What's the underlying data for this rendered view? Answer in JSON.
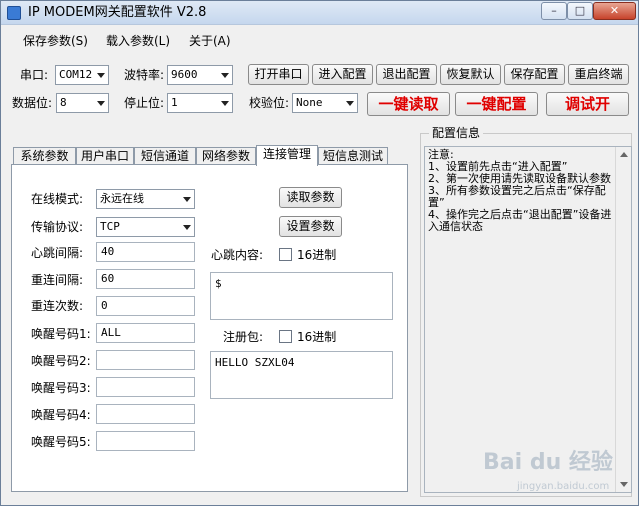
{
  "window": {
    "title": "IP MODEM网关配置软件 V2.8"
  },
  "menu": [
    "保存参数(S)",
    "载入参数(L)",
    "关于(A)"
  ],
  "serial": {
    "port_label": "串口:",
    "port_value": "COM12",
    "baud_label": "波特率:",
    "baud_value": "9600",
    "databits_label": "数据位:",
    "databits_value": "8",
    "stopbits_label": "停止位:",
    "stopbits_value": "1",
    "parity_label": "校验位:",
    "parity_value": "None"
  },
  "toolbar_buttons": [
    "打开串口",
    "进入配置",
    "退出配置",
    "恢复默认",
    "保存配置",
    "重启终端"
  ],
  "action_buttons": [
    "一键读取",
    "一键配置",
    "调试开"
  ],
  "tabs": [
    "系统参数",
    "用户串口",
    "短信通道",
    "网络参数",
    "连接管理",
    "短信息测试"
  ],
  "conn": {
    "online_mode_label": "在线模式:",
    "online_mode_value": "永远在线",
    "protocol_label": "传输协议:",
    "protocol_value": "TCP",
    "read_params_label": "读取参数",
    "set_params_label": "设置参数",
    "heartbeat_interval_label": "心跳间隔:",
    "heartbeat_interval_value": "40",
    "reconnect_interval_label": "重连间隔:",
    "reconnect_interval_value": "60",
    "reconnect_count_label": "重连次数:",
    "reconnect_count_value": "0",
    "wake1_label": "唤醒号码1:",
    "wake1_value": "ALL",
    "wake2_label": "唤醒号码2:",
    "wake3_label": "唤醒号码3:",
    "wake4_label": "唤醒号码4:",
    "wake5_label": "唤醒号码5:",
    "heartbeat_content_label": "心跳内容:",
    "hex_label": "16进制",
    "heartbeat_content_value": "$",
    "register_label": "注册包:",
    "register_hex_label": "16进制",
    "register_value": "HELLO SZXL04"
  },
  "config_info": {
    "title": "配置信息",
    "lines": [
      "注意:",
      "1、设置前先点击“进入配置”",
      "2、第一次使用请先读取设备默认参数",
      "3、所有参数设置完之后点击“保存配置”",
      "4、操作完之后点击“退出配置”设备进入通信状态"
    ]
  },
  "watermark": {
    "text": "Bai du 经验",
    "sub": "jingyan.baidu.com"
  }
}
